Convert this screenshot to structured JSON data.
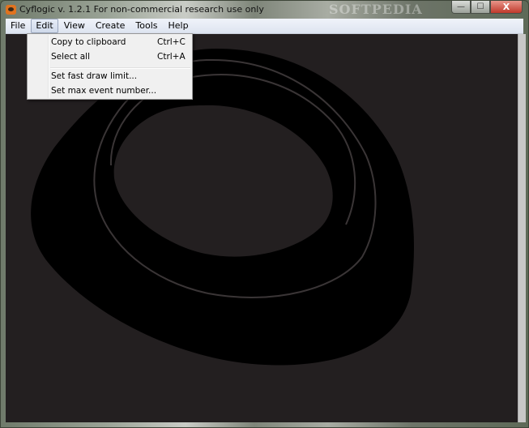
{
  "window": {
    "title": "Cyflogic v. 1.2.1 For non-commercial research use only",
    "watermark": "SOFTPEDIA",
    "controls": {
      "minimize_glyph": "—",
      "maximize_glyph": "☐",
      "close_glyph": "X"
    }
  },
  "menubar": {
    "items": [
      {
        "label": "File"
      },
      {
        "label": "Edit",
        "active": true
      },
      {
        "label": "View"
      },
      {
        "label": "Create"
      },
      {
        "label": "Tools"
      },
      {
        "label": "Help"
      }
    ]
  },
  "edit_menu": {
    "items": [
      {
        "label": "Copy to clipboard",
        "shortcut": "Ctrl+C"
      },
      {
        "label": "Select all",
        "shortcut": "Ctrl+A"
      },
      {
        "label": "Set fast draw limit...",
        "shortcut": ""
      },
      {
        "label": "Set max event number...",
        "shortcut": ""
      }
    ]
  },
  "colors": {
    "canvas_background": "#231f20",
    "shape_fill": "#000000",
    "close_button": "#c0392b",
    "menu_background": "#f0f0f0"
  }
}
